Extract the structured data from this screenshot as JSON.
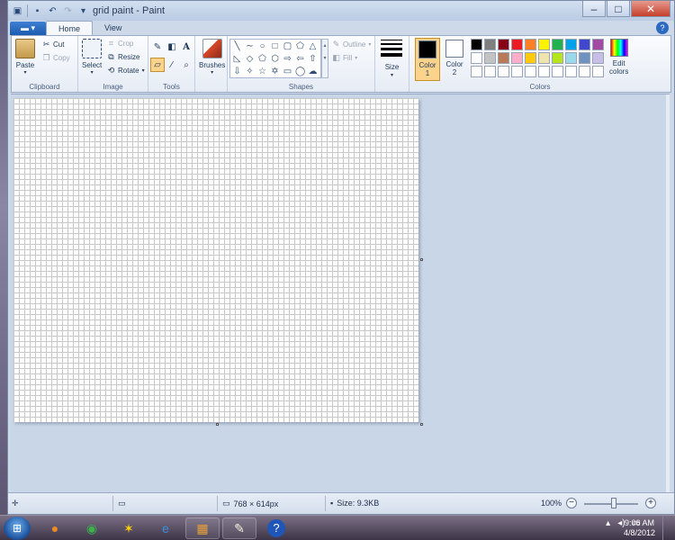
{
  "window": {
    "title": "grid paint - Paint",
    "tabs": [
      "Home",
      "View"
    ],
    "help": "?"
  },
  "ribbon": {
    "clipboard": {
      "label": "Clipboard",
      "paste": "Paste",
      "cut": "Cut",
      "copy": "Copy"
    },
    "image": {
      "label": "Image",
      "select": "Select",
      "crop": "Crop",
      "resize": "Resize",
      "rotate": "Rotate"
    },
    "tools": {
      "label": "Tools",
      "text_tool": "A"
    },
    "brushes": {
      "label": "Brushes"
    },
    "shapes": {
      "label": "Shapes",
      "outline": "Outline",
      "fill": "Fill"
    },
    "size": {
      "label": "Size"
    },
    "colors": {
      "label": "Colors",
      "color1_label": "Color",
      "color1_num": "1",
      "color2_label": "Color",
      "color2_num": "2",
      "edit_label": "Edit",
      "edit_label2": "colors",
      "color1": "#000000",
      "color2": "#ffffff",
      "palette": [
        "#000000",
        "#7f7f7f",
        "#880015",
        "#ed1c24",
        "#ff7f27",
        "#fff200",
        "#22b14c",
        "#00a2e8",
        "#3f48cc",
        "#a349a4",
        "#ffffff",
        "#c3c3c3",
        "#b97a57",
        "#ffaec9",
        "#ffc90e",
        "#efe4b0",
        "#b5e61d",
        "#99d9ea",
        "#7092be",
        "#c8bfe7",
        "#ffffff",
        "#ffffff",
        "#ffffff",
        "#ffffff",
        "#ffffff",
        "#ffffff",
        "#ffffff",
        "#ffffff",
        "#ffffff",
        "#ffffff"
      ]
    }
  },
  "status": {
    "dimensions": "768 × 614px",
    "size": "Size: 9.3KB",
    "zoom": "100%"
  },
  "taskbar": {
    "time": "9:06 AM",
    "date": "4/8/2012",
    "apps": [
      "firefox-icon",
      "chrome-icon",
      "aim-icon",
      "ie-icon",
      "office-icon",
      "paint-icon",
      "help-icon"
    ]
  }
}
